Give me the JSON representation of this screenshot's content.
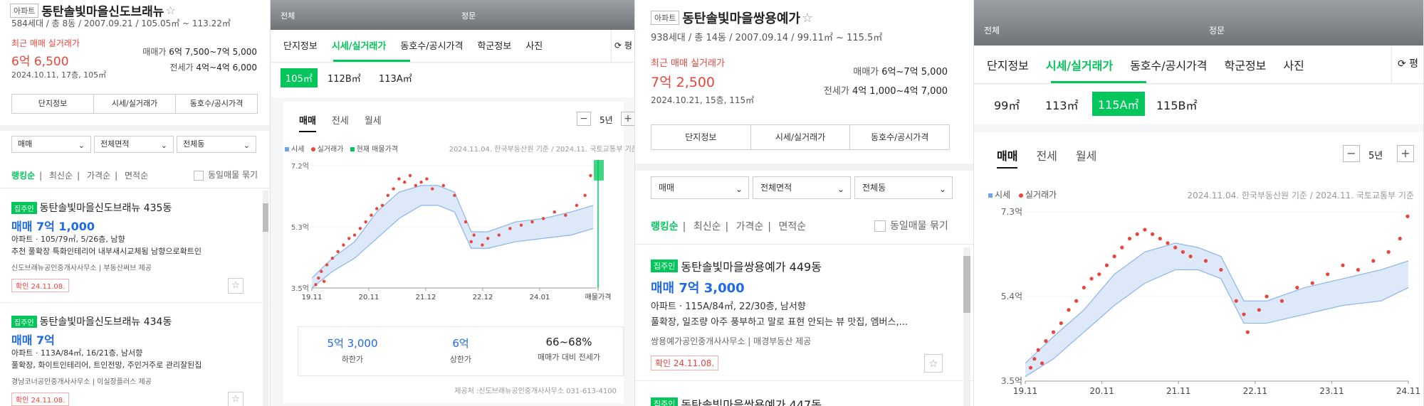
{
  "colors": {
    "green": "#03c75a",
    "red": "#e8453c",
    "blue": "#1e6ae8",
    "band": "#dde9f8"
  },
  "panel1": {
    "badge": "아파트",
    "complex_name": "동탄솔빛마을신도브래뉴",
    "info": "584세대 / 총 8동 / 2007.09.21 / 105.05㎡ ~ 113.22㎡",
    "recent_label": "최근 매매 실거래가",
    "recent_price": "6억 6,500",
    "recent_date": "2024.10.11, 17층, 105㎡",
    "sale_label": "매매가",
    "sale_range": "6억 7,500~7억 5,000",
    "jeonse_label": "전세가",
    "jeonse_range": "4억~4억 6,000",
    "buttons": [
      "단지정보",
      "시세/실거래가",
      "동호수/공시가격"
    ],
    "filters": [
      "매매",
      "전체면적",
      "전체동"
    ],
    "sorts": [
      "랭킹순",
      "최신순",
      "가격순",
      "면적순"
    ],
    "group_label": "동일매물 묶기",
    "listings": [
      {
        "tag": "집주인",
        "name": "동탄솔빛마을신도브래뉴 435동",
        "price": "매매 7억 1,000",
        "spec": "아파트 · 105/79㎡, 5/26층, 남향",
        "desc": "추천 풀확장 특화인테리어 내부새시교체됨 남향으로확트인",
        "agent": "신도브래뉴공인중개사사무소 | 부동산써브 제공",
        "confirm": "확인 24.11.08."
      },
      {
        "tag": "집주인",
        "name": "동탄솔빛마을신도브래뉴 434동",
        "price": "매매 7억",
        "spec": "아파트 · 113A/84㎡, 16/21층, 남서향",
        "desc": "풀확장, 화이트인테리어, 트인전망, 주인거주로 관리잘된집",
        "agent": "경남코너공인중개사사무소 | 이실장플러스 제공",
        "confirm": "확인 24.11.08."
      }
    ]
  },
  "panel2": {
    "photo_labels": [
      "전체",
      "정문"
    ],
    "tabs": [
      "단지정보",
      "시세/실거래가",
      "동호수/공시가격",
      "학군정보",
      "사진"
    ],
    "more": "⟳ 평",
    "sizes": [
      "105㎡",
      "112B㎡",
      "113A㎡"
    ],
    "deal_tabs": [
      "매매",
      "전세",
      "월세"
    ],
    "period": "5년",
    "legend": [
      "시세",
      "실거래가",
      "현재 매물가격"
    ],
    "source": "2024.11.04. 한국부동산원 기준 / 2024.11. 국토교통부 기준",
    "stats": [
      {
        "value": "5억 3,000",
        "label": "하한가"
      },
      {
        "value": "6억",
        "label": "상한가"
      },
      {
        "value": "66~68%",
        "label": "매매가 대비 전세가"
      }
    ],
    "provider": "제공처 :신도브래뉴공인중개사사무소 031-613-4100"
  },
  "panel3": {
    "badge": "아파트",
    "complex_name": "동탄솔빛마을쌍용예가",
    "info": "938세대 / 총 14동 / 2007.09.14 / 99.11㎡ ~ 115.5㎡",
    "recent_label": "최근 매매 실거래가",
    "recent_price": "7억 2,500",
    "recent_date": "2024.10.21, 15층, 115㎡",
    "sale_label": "매매가",
    "sale_range": "6억~7억 5,000",
    "jeonse_label": "전세가",
    "jeonse_range": "4억 1,000~4억 7,000",
    "buttons": [
      "단지정보",
      "시세/실거래가",
      "동호수/공시가격"
    ],
    "filters": [
      "매매",
      "전체면적",
      "전체동"
    ],
    "sorts": [
      "랭킹순",
      "최신순",
      "가격순",
      "면적순"
    ],
    "group_label": "동일매물 묶기",
    "listings": [
      {
        "tag": "집주인",
        "name": "동탄솔빛마을쌍용예가 449동",
        "price": "매매 7억 3,000",
        "spec": "아파트 · 115A/84㎡, 22/30층, 남서향",
        "desc": "풀확장, 일조량 아주 풍부하고 말로 표현 안되는 뷰 맛집, 엠버스,...",
        "agent": "쌍용예가공인중개사사무소 | 매경부동산 제공",
        "confirm": "확인 24.11.08."
      },
      {
        "tag": "집주인",
        "name": "동탄솔빛마을쌍용예가 447동",
        "price": "",
        "spec": "",
        "desc": "",
        "agent": "",
        "confirm": ""
      }
    ]
  },
  "panel4": {
    "photo_labels": [
      "전체",
      "정문"
    ],
    "tabs": [
      "단지정보",
      "시세/실거래가",
      "동호수/공시가격",
      "학군정보",
      "사진"
    ],
    "more": "⟳ 평",
    "sizes": [
      "99㎡",
      "113㎡",
      "115A㎡",
      "115B㎡"
    ],
    "deal_tabs": [
      "매매",
      "전세",
      "월세"
    ],
    "period": "5년",
    "legend": [
      "시세",
      "실거래가"
    ],
    "source": "2024.11.04. 한국부동산원 기준 / 2024.11. 국토교통부 기준"
  },
  "chart_data": [
    {
      "type": "line",
      "title": "",
      "unit": "억",
      "x_ticks": [
        "19.11",
        "20.11",
        "21.12",
        "22.12",
        "24.01",
        "매물가격"
      ],
      "y_ticks": [
        "3.5억",
        "5.3억",
        "7.2억"
      ],
      "ylim": [
        3.5,
        7.2
      ],
      "x_range": [
        2019.83,
        2024.96
      ],
      "market_band_low": [
        [
          2019.83,
          3.5
        ],
        [
          2020.2,
          4.0
        ],
        [
          2020.6,
          4.4
        ],
        [
          2021.0,
          5.0
        ],
        [
          2021.4,
          5.6
        ],
        [
          2021.8,
          6.0
        ],
        [
          2022.1,
          6.0
        ],
        [
          2022.4,
          5.8
        ],
        [
          2022.7,
          4.7
        ],
        [
          2023.0,
          4.7
        ],
        [
          2023.5,
          4.9
        ],
        [
          2024.0,
          5.0
        ],
        [
          2024.5,
          5.1
        ],
        [
          2024.9,
          5.3
        ]
      ],
      "market_band_high": [
        [
          2019.83,
          3.8
        ],
        [
          2020.2,
          4.4
        ],
        [
          2020.6,
          4.9
        ],
        [
          2021.0,
          5.8
        ],
        [
          2021.4,
          6.4
        ],
        [
          2021.8,
          6.6
        ],
        [
          2022.1,
          6.6
        ],
        [
          2022.4,
          6.4
        ],
        [
          2022.7,
          5.2
        ],
        [
          2023.0,
          5.2
        ],
        [
          2023.5,
          5.5
        ],
        [
          2024.0,
          5.6
        ],
        [
          2024.5,
          5.8
        ],
        [
          2024.9,
          6.0
        ]
      ],
      "transactions": [
        [
          2019.9,
          3.6
        ],
        [
          2019.95,
          3.8
        ],
        [
          2020.0,
          4.0
        ],
        [
          2020.05,
          3.7
        ],
        [
          2020.1,
          4.2
        ],
        [
          2020.2,
          4.4
        ],
        [
          2020.3,
          4.6
        ],
        [
          2020.4,
          4.8
        ],
        [
          2020.5,
          5.0
        ],
        [
          2020.6,
          5.1
        ],
        [
          2020.7,
          5.3
        ],
        [
          2020.8,
          5.5
        ],
        [
          2020.9,
          5.7
        ],
        [
          2021.0,
          5.9
        ],
        [
          2021.1,
          6.0
        ],
        [
          2021.2,
          6.3
        ],
        [
          2021.3,
          6.5
        ],
        [
          2021.4,
          6.8
        ],
        [
          2021.5,
          6.7
        ],
        [
          2021.6,
          6.9
        ],
        [
          2021.7,
          6.6
        ],
        [
          2021.8,
          6.7
        ],
        [
          2021.9,
          6.8
        ],
        [
          2022.0,
          6.5
        ],
        [
          2022.2,
          6.6
        ],
        [
          2022.4,
          6.3
        ],
        [
          2022.6,
          5.5
        ],
        [
          2022.7,
          4.9
        ],
        [
          2022.75,
          5.1
        ],
        [
          2022.9,
          4.8
        ],
        [
          2023.0,
          5.0
        ],
        [
          2023.2,
          5.1
        ],
        [
          2023.4,
          5.3
        ],
        [
          2023.6,
          5.4
        ],
        [
          2023.8,
          5.5
        ],
        [
          2024.0,
          5.6
        ],
        [
          2024.2,
          5.8
        ],
        [
          2024.4,
          5.7
        ],
        [
          2024.6,
          6.0
        ],
        [
          2024.75,
          6.3
        ],
        [
          2024.85,
          6.9
        ]
      ],
      "listing_price_range": [
        6.75,
        7.5
      ]
    },
    {
      "type": "line",
      "title": "",
      "unit": "억",
      "x_ticks": [
        "19.11",
        "20.11",
        "21.11",
        "22.11",
        "23.11",
        "24.11"
      ],
      "y_ticks": [
        "3.5억",
        "5.4억",
        "7.3억"
      ],
      "ylim": [
        3.5,
        7.3
      ],
      "x_range": [
        2019.83,
        2024.86
      ],
      "market_band_low": [
        [
          2019.83,
          3.6
        ],
        [
          2020.2,
          4.0
        ],
        [
          2020.6,
          4.6
        ],
        [
          2021.0,
          5.2
        ],
        [
          2021.4,
          5.7
        ],
        [
          2021.8,
          6.0
        ],
        [
          2022.1,
          6.0
        ],
        [
          2022.4,
          5.8
        ],
        [
          2022.7,
          4.8
        ],
        [
          2023.0,
          4.8
        ],
        [
          2023.5,
          5.0
        ],
        [
          2024.0,
          5.2
        ],
        [
          2024.5,
          5.3
        ],
        [
          2024.86,
          5.6
        ]
      ],
      "market_band_high": [
        [
          2019.83,
          3.9
        ],
        [
          2020.2,
          4.5
        ],
        [
          2020.6,
          5.1
        ],
        [
          2021.0,
          5.9
        ],
        [
          2021.4,
          6.4
        ],
        [
          2021.8,
          6.6
        ],
        [
          2022.1,
          6.5
        ],
        [
          2022.4,
          6.3
        ],
        [
          2022.7,
          5.3
        ],
        [
          2023.0,
          5.3
        ],
        [
          2023.5,
          5.6
        ],
        [
          2024.0,
          5.8
        ],
        [
          2024.5,
          6.0
        ],
        [
          2024.86,
          6.2
        ]
      ],
      "transactions": [
        [
          2019.9,
          3.8
        ],
        [
          2019.95,
          4.0
        ],
        [
          2020.0,
          4.2
        ],
        [
          2020.05,
          3.9
        ],
        [
          2020.1,
          4.4
        ],
        [
          2020.2,
          4.6
        ],
        [
          2020.3,
          4.8
        ],
        [
          2020.4,
          5.1
        ],
        [
          2020.5,
          5.3
        ],
        [
          2020.6,
          5.6
        ],
        [
          2020.7,
          5.8
        ],
        [
          2020.8,
          5.9
        ],
        [
          2020.9,
          6.1
        ],
        [
          2021.0,
          6.3
        ],
        [
          2021.1,
          6.5
        ],
        [
          2021.2,
          6.7
        ],
        [
          2021.3,
          6.8
        ],
        [
          2021.4,
          6.9
        ],
        [
          2021.5,
          6.8
        ],
        [
          2021.6,
          6.7
        ],
        [
          2021.7,
          6.6
        ],
        [
          2021.8,
          6.5
        ],
        [
          2021.9,
          6.4
        ],
        [
          2022.0,
          6.3
        ],
        [
          2022.2,
          6.2
        ],
        [
          2022.4,
          6.0
        ],
        [
          2022.6,
          5.3
        ],
        [
          2022.7,
          5.0
        ],
        [
          2022.75,
          4.6
        ],
        [
          2022.9,
          5.1
        ],
        [
          2023.0,
          5.4
        ],
        [
          2023.2,
          5.3
        ],
        [
          2023.4,
          5.6
        ],
        [
          2023.6,
          5.7
        ],
        [
          2023.8,
          5.9
        ],
        [
          2024.0,
          6.1
        ],
        [
          2024.2,
          6.0
        ],
        [
          2024.4,
          6.2
        ],
        [
          2024.6,
          6.4
        ],
        [
          2024.75,
          6.7
        ],
        [
          2024.85,
          7.2
        ]
      ]
    }
  ]
}
